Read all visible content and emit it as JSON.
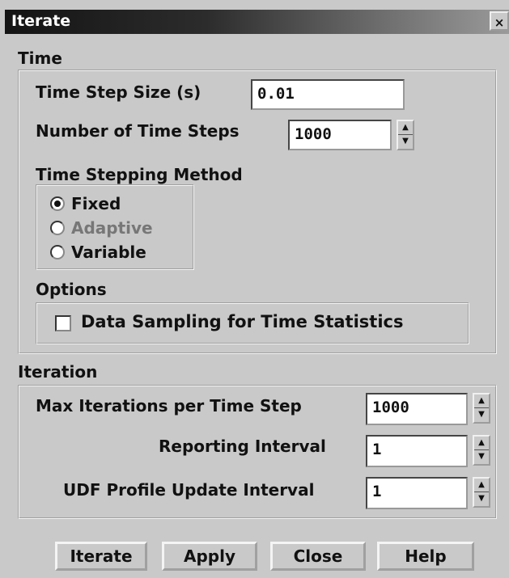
{
  "window": {
    "title": "Iterate",
    "close_glyph": "×"
  },
  "time": {
    "section_label": "Time",
    "time_step_size": {
      "label": "Time Step Size (s)",
      "value": "0.01"
    },
    "num_time_steps": {
      "label": "Number of Time Steps",
      "value": "1000"
    },
    "method": {
      "label": "Time Stepping Method",
      "options": [
        {
          "label": "Fixed",
          "selected": true,
          "enabled": true
        },
        {
          "label": "Adaptive",
          "selected": false,
          "enabled": false
        },
        {
          "label": "Variable",
          "selected": false,
          "enabled": true
        }
      ]
    },
    "options": {
      "label": "Options",
      "data_sampling": {
        "label": "Data Sampling for Time Statistics",
        "checked": false
      }
    }
  },
  "iteration": {
    "section_label": "Iteration",
    "max_iter": {
      "label": "Max Iterations per Time Step",
      "value": "1000"
    },
    "reporting": {
      "label": "Reporting Interval",
      "value": "1"
    },
    "udf": {
      "label": "UDF Profile Update Interval",
      "value": "1"
    }
  },
  "buttons": {
    "iterate": "Iterate",
    "apply": "Apply",
    "close": "Close",
    "help": "Help"
  },
  "icons": {
    "spinner_up": "▲",
    "spinner_down": "▼"
  }
}
